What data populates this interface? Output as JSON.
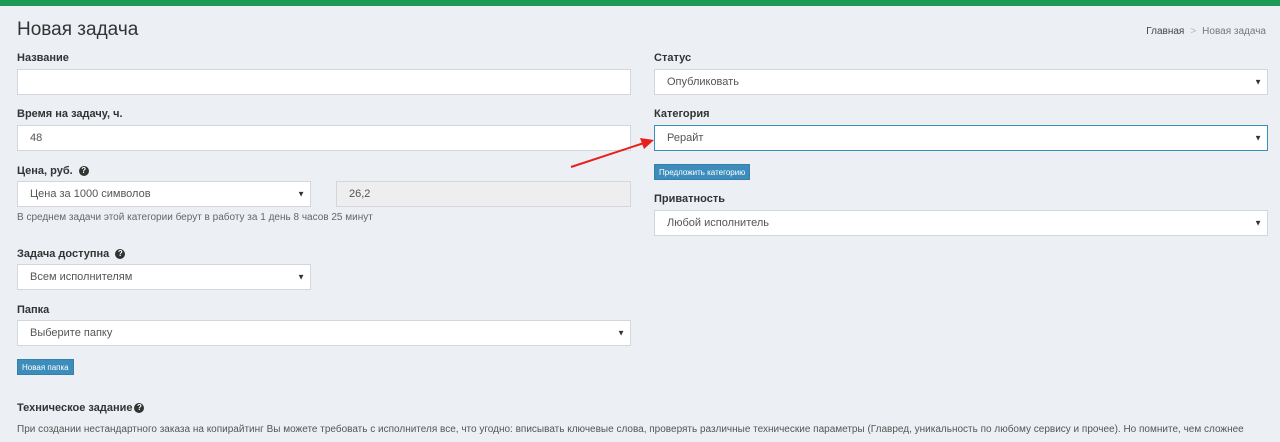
{
  "page": {
    "title": "Новая задача"
  },
  "breadcrumb": {
    "home": "Главная",
    "separator": ">",
    "current": "Новая задача"
  },
  "form": {
    "name": {
      "label": "Название",
      "value": ""
    },
    "time": {
      "label": "Время на задачу, ч.",
      "value": "48"
    },
    "price": {
      "label": "Цена, руб.",
      "type_selected": "Цена за 1000 символов",
      "amount": "26,2",
      "hint": "В среднем задачи этой категории берут в работу за 1 день 8 часов 25 минут"
    },
    "availability": {
      "label": "Задача доступна",
      "selected": "Всем исполнителям"
    },
    "folder": {
      "label": "Папка",
      "selected": "Выберите папку",
      "new_button": "Новая папка"
    },
    "status": {
      "label": "Статус",
      "selected": "Опубликовать"
    },
    "category": {
      "label": "Категория",
      "selected": "Рерайт",
      "suggest_button": "Предложить категорию"
    },
    "privacy": {
      "label": "Приватность",
      "selected": "Любой исполнитель"
    },
    "spec": {
      "label": "Техническое задание",
      "text": "При создании нестандартного заказа на копирайтинг Вы можете требовать с исполнителя все, что угодно: вписывать ключевые слова, проверять различные технические параметры (Главред, уникальность по любому сервису и прочее). Но помните, чем сложнее"
    }
  },
  "icons": {
    "help": "question-circle-icon",
    "caret": "caret-down-icon"
  },
  "colors": {
    "topbar": "#1e9a57",
    "accent": "#3c8dbc",
    "annotation_arrow": "#e8201c"
  }
}
